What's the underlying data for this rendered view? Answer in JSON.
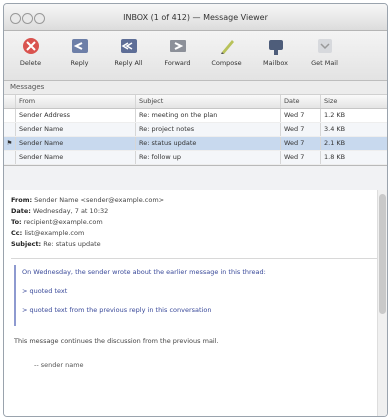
{
  "window": {
    "title": "INBOX (1 of 412) — Message Viewer"
  },
  "toolbar": {
    "items": [
      {
        "label": "Delete",
        "icon": "delete-icon"
      },
      {
        "label": "Reply",
        "icon": "reply-icon"
      },
      {
        "label": "Reply All",
        "icon": "reply-all-icon"
      },
      {
        "label": "Forward",
        "icon": "forward-icon"
      },
      {
        "label": "Compose",
        "icon": "compose-icon"
      },
      {
        "label": "Mailbox",
        "icon": "mailbox-icon"
      },
      {
        "label": "Get Mail",
        "icon": "get-mail-icon"
      }
    ]
  },
  "message_list": {
    "section_label": "Messages",
    "columns": [
      "",
      "From",
      "Subject",
      "Date",
      "Size"
    ],
    "rows": [
      {
        "flag": "",
        "from": "Sender Address",
        "subject": "Re: meeting on the plan",
        "date": "Wed 7",
        "size": "1.2 KB"
      },
      {
        "flag": "",
        "from": "Sender Name",
        "subject": "Re: project notes",
        "date": "Wed 7",
        "size": "3.4 KB"
      },
      {
        "flag": "⚑",
        "from": "Sender Name",
        "subject": "Re: status update",
        "date": "Wed 7",
        "size": "2.1 KB"
      },
      {
        "flag": "",
        "from": "Sender Name",
        "subject": "Re: follow up",
        "date": "Wed 7",
        "size": "1.8 KB"
      }
    ]
  },
  "preview": {
    "headers": [
      {
        "label": "From:",
        "value": "Sender Name <sender@example.com>"
      },
      {
        "label": "Date:",
        "value": "Wednesday, 7 at 10:32"
      },
      {
        "label": "To:",
        "value": "recipient@example.com"
      },
      {
        "label": "Cc:",
        "value": "list@example.com"
      },
      {
        "label": "Subject:",
        "value": "Re: status update"
      }
    ],
    "quote_lines": [
      "On Wednesday, the sender wrote about the earlier message in this thread:",
      "> quoted text",
      "> quoted text from the previous reply in this conversation"
    ],
    "body": "This message continues the discussion from the previous mail.",
    "signature": "-- sender name"
  }
}
